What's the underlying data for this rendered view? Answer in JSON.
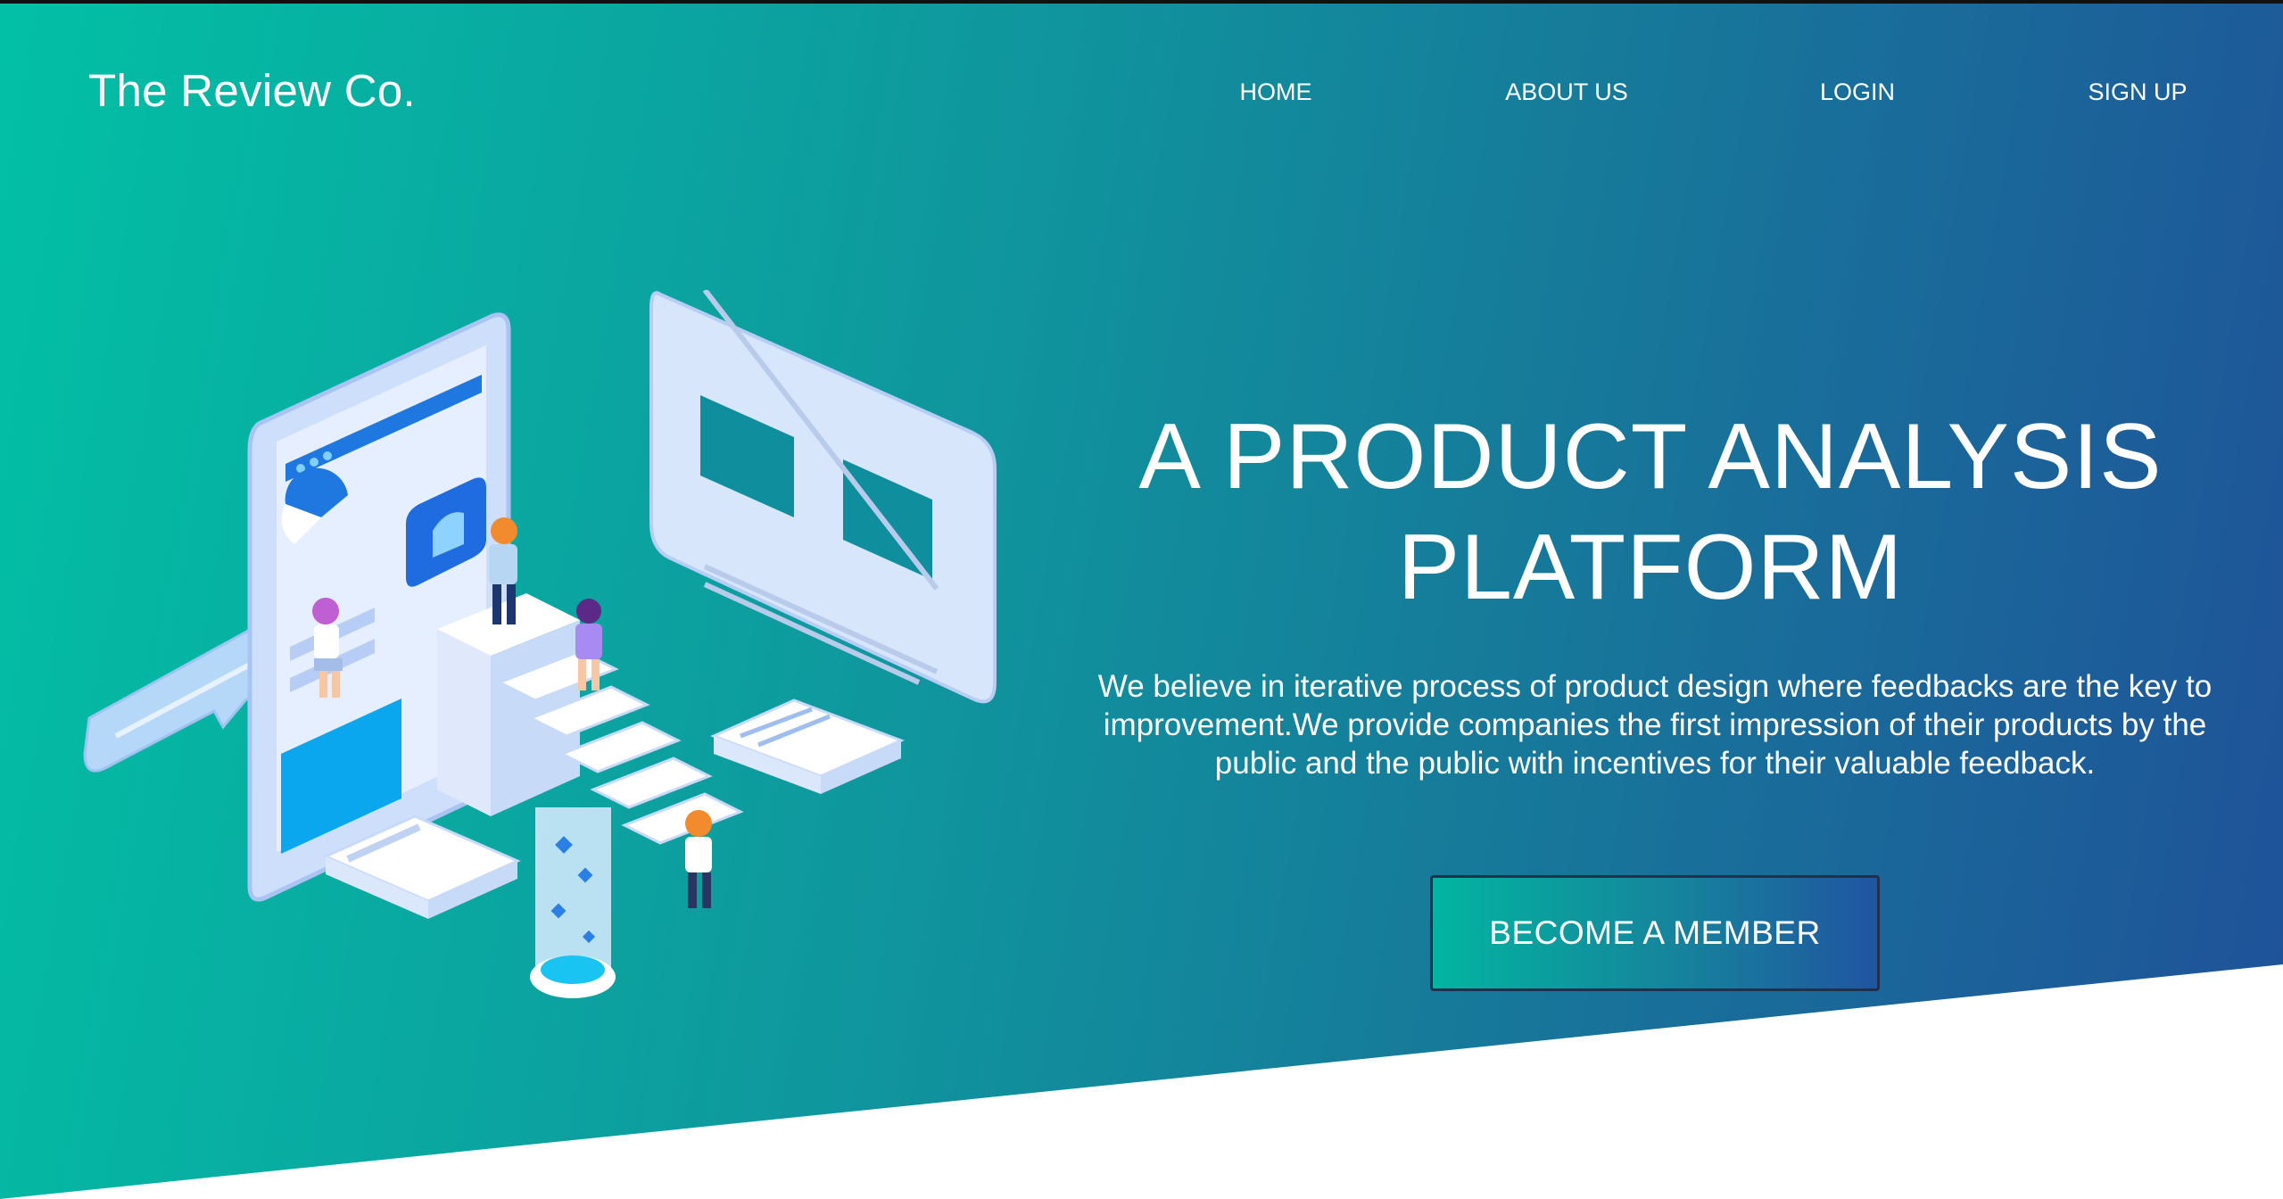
{
  "brand": {
    "name": "The Review Co."
  },
  "nav": {
    "items": [
      {
        "label": "HOME"
      },
      {
        "label": "ABOUT US"
      },
      {
        "label": "LOGIN"
      },
      {
        "label": "SIGN UP"
      }
    ]
  },
  "hero": {
    "title": "A PRODUCT ANALYSIS PLATFORM",
    "description": "We believe in iterative process of product design where feedbacks are the key to improvement.We provide companies the first impression of their products by the public and the public with incentives for their valuable feedback.",
    "cta_label": "BECOME A MEMBER"
  },
  "colors": {
    "gradient_start": "#02c0a5",
    "gradient_end": "#1f5199",
    "text": "#ffffff",
    "illustration_light": "#cfe0fb",
    "illustration_accent": "#1aa6ee"
  }
}
